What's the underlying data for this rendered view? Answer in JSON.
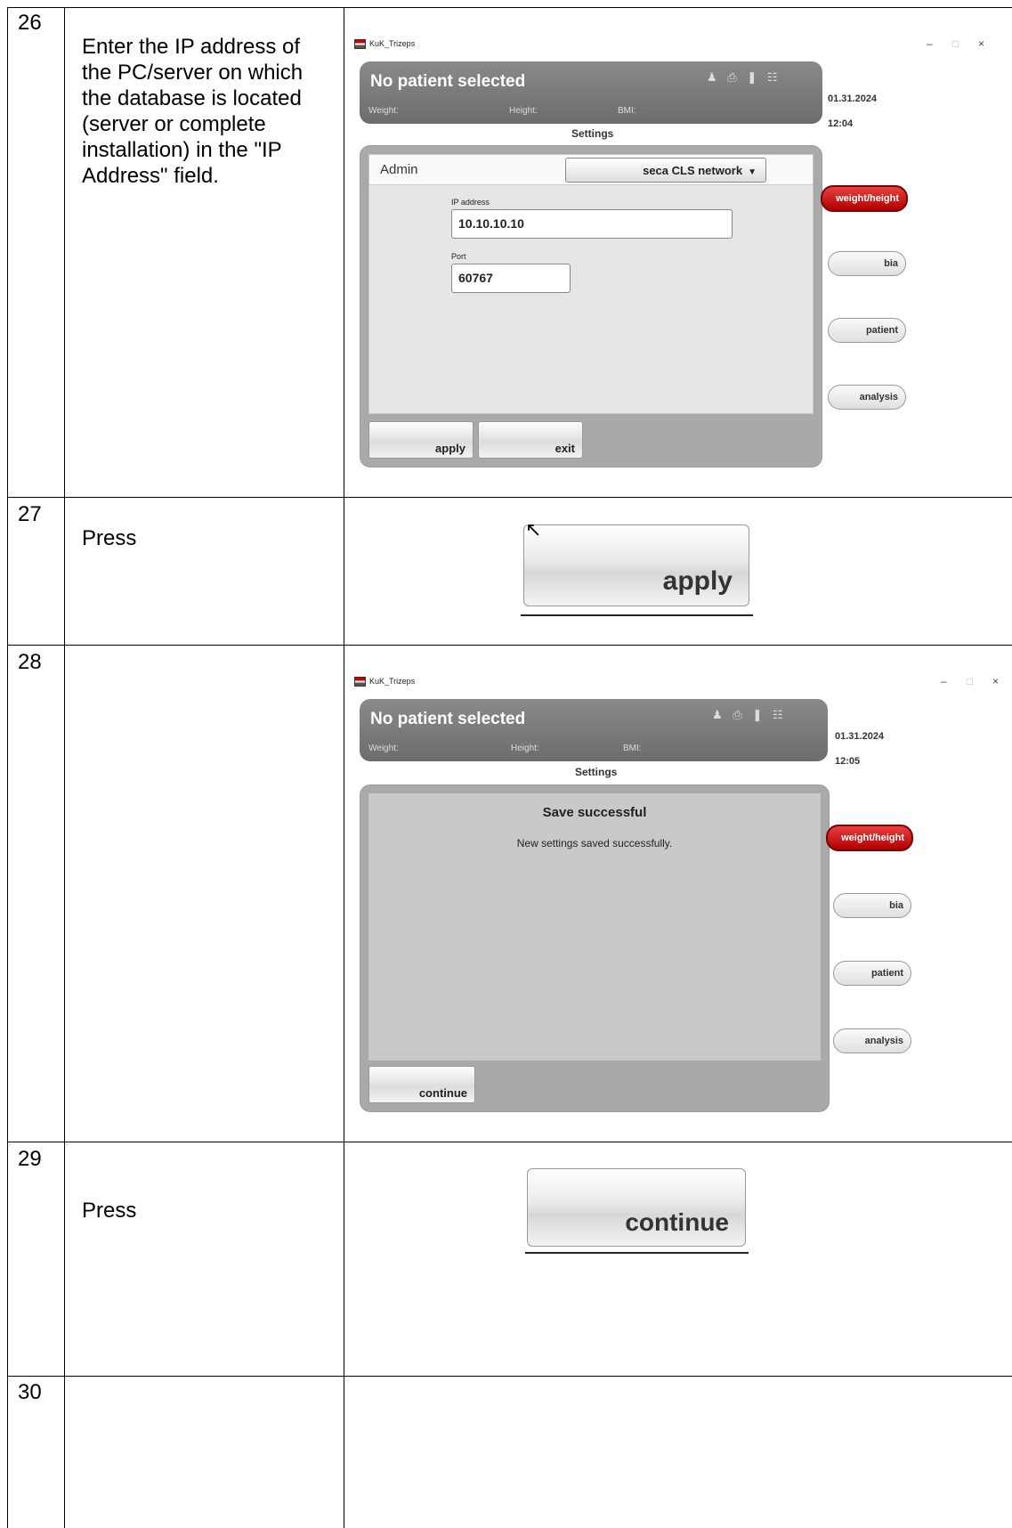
{
  "steps": [
    {
      "number": "26",
      "text": "Enter the IP address of\nthe PC/server on which\nthe database is located\n(server or complete\ninstallation) in the \"IP\nAddress\" field."
    },
    {
      "number": "27",
      "text": "Press"
    },
    {
      "number": "28",
      "text": ""
    },
    {
      "number": "29",
      "text": "Press"
    },
    {
      "number": "30",
      "text": ""
    }
  ],
  "window1": {
    "title": "KuK_Trizeps",
    "controls": [
      "–",
      "□",
      "×"
    ],
    "patient": "No patient selected",
    "weight_label": "Weight:",
    "height_label": "Height:",
    "bmi_label": "BMI:",
    "date": "01.31.2024",
    "time": "12:04",
    "settings_label": "Settings",
    "admin_label": "Admin",
    "dropdown_value": "seca CLS network",
    "ip_label": "IP address",
    "ip_value": "10.10.10.10",
    "port_label": "Port",
    "port_value": "60767",
    "apply": "apply",
    "exit": "exit",
    "side_buttons": [
      "weight/height",
      "bia",
      "patient",
      "analysis"
    ],
    "status_icons": [
      "person-icon",
      "printer-icon",
      "wireless-icon",
      "network-icon"
    ]
  },
  "step27_button": "apply",
  "window2": {
    "title": "KuK_Trizeps",
    "controls": [
      "–",
      "□",
      "×"
    ],
    "patient": "No patient selected",
    "weight_label": "Weight:",
    "height_label": "Height:",
    "bmi_label": "BMI:",
    "date": "01.31.2024",
    "time": "12:05",
    "settings_label": "Settings",
    "msg_title": "Save successful",
    "msg_text": "New settings saved successfully.",
    "continue": "continue",
    "side_buttons": [
      "weight/height",
      "bia",
      "patient",
      "analysis"
    ]
  },
  "step29_button": "continue"
}
